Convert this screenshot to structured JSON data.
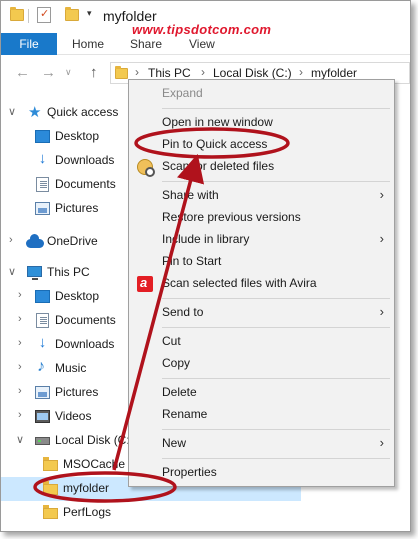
{
  "window": {
    "title": "myfolder",
    "quick_access_dropdown": "▾"
  },
  "watermark": "www.tipsdotcom.com",
  "ribbon": {
    "tabs": [
      "File",
      "Home",
      "Share",
      "View"
    ]
  },
  "navigation": {
    "back": "←",
    "forward": "→",
    "recent": "∨",
    "up": "↑",
    "breadcrumb": [
      "This PC",
      "Local Disk (C:)",
      "myfolder"
    ],
    "separator": "›"
  },
  "tree": {
    "expand_chevron": "›",
    "collapse_chevron": "∨",
    "items": [
      {
        "label": "Quick access",
        "icon": "star-icon"
      },
      {
        "label": "Desktop",
        "icon": "desktop-icon"
      },
      {
        "label": "Downloads",
        "icon": "downloads-icon"
      },
      {
        "label": "Documents",
        "icon": "documents-icon"
      },
      {
        "label": "Pictures",
        "icon": "pictures-icon"
      },
      {
        "label": "OneDrive",
        "icon": "onedrive-icon"
      },
      {
        "label": "This PC",
        "icon": "pc-icon"
      },
      {
        "label": "Desktop",
        "icon": "desktop-icon"
      },
      {
        "label": "Documents",
        "icon": "documents-icon"
      },
      {
        "label": "Downloads",
        "icon": "downloads-icon"
      },
      {
        "label": "Music",
        "icon": "music-icon"
      },
      {
        "label": "Pictures",
        "icon": "pictures-icon"
      },
      {
        "label": "Videos",
        "icon": "videos-icon"
      },
      {
        "label": "Local Disk (C:)",
        "icon": "disk-icon"
      },
      {
        "label": "MSOCache",
        "icon": "folder-icon"
      },
      {
        "label": "myfolder",
        "icon": "folder-icon",
        "selected": true
      },
      {
        "label": "PerfLogs",
        "icon": "folder-icon"
      }
    ]
  },
  "context_menu": {
    "submenu_arrow": "›",
    "items": [
      {
        "label": "Expand",
        "disabled": true
      },
      {
        "label": "Open in new window"
      },
      {
        "label": "Pin to Quick access",
        "highlighted": true
      },
      {
        "label": "Scan for deleted files",
        "icon": "scan-icon"
      },
      {
        "label": "Share with",
        "submenu": true
      },
      {
        "label": "Restore previous versions"
      },
      {
        "label": "Include in library",
        "submenu": true
      },
      {
        "label": "Pin to Start"
      },
      {
        "label": "Scan selected files with Avira",
        "icon": "avira-icon"
      },
      {
        "label": "Send to",
        "submenu": true
      },
      {
        "label": "Cut"
      },
      {
        "label": "Copy"
      },
      {
        "label": "Delete"
      },
      {
        "label": "Rename"
      },
      {
        "label": "New",
        "submenu": true
      },
      {
        "label": "Properties"
      }
    ]
  },
  "colors": {
    "file_tab": "#1979ca",
    "selection": "#cce8ff",
    "annotation": "#b0121c",
    "watermark": "#e0182e",
    "menu_background": "#f2f2f2"
  }
}
